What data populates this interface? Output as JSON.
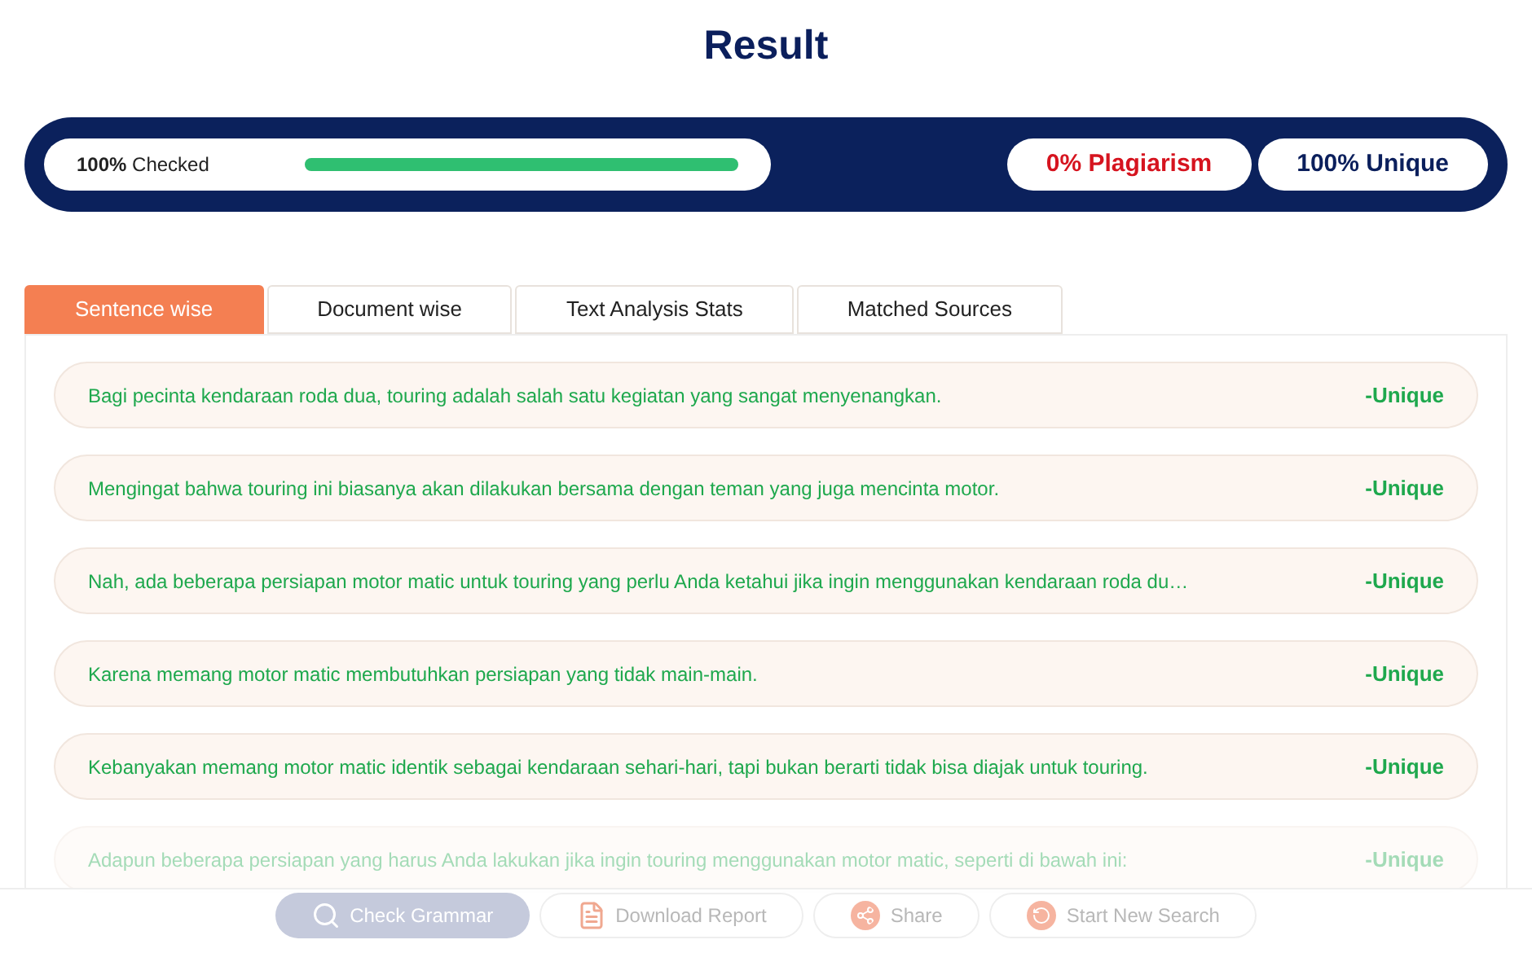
{
  "title": "Result",
  "summary": {
    "checked_label": "**100%** Checked",
    "level": 1,
    "plagiarism": "0% Plagiarism",
    "unique": "100% Unique"
  },
  "tabs": [
    {
      "label": "Sentence wise",
      "selected": true
    },
    {
      "label": "Document wise",
      "selected": false
    },
    {
      "label": "Text Analysis Stats",
      "selected": false
    },
    {
      "label": "Matched Sources",
      "selected": false
    }
  ],
  "sentences": [
    {
      "text": "Bagi pecinta kendaraan roda dua, touring adalah salah satu kegiatan yang sangat menyenangkan.",
      "status": "-Unique"
    },
    {
      "text": "Mengingat bahwa touring ini biasanya akan dilakukan bersama dengan teman yang juga mencinta motor.",
      "status": "-Unique"
    },
    {
      "text": "Nah, ada beberapa persiapan motor matic untuk touring yang perlu Anda ketahui jika ingin menggunakan kendaraan roda du…",
      "status": "-Unique"
    },
    {
      "text": "Karena memang motor matic membutuhkan persiapan yang tidak main-main.",
      "status": "-Unique"
    },
    {
      "text": "Kebanyakan memang motor matic identik sebagai kendaraan sehari-hari, tapi bukan berarti tidak bisa diajak untuk touring.",
      "status": "-Unique"
    },
    {
      "text": "Adapun beberapa persiapan yang harus Anda lakukan jika ingin touring menggunakan motor matic, seperti di bawah ini:",
      "status": "-Unique"
    }
  ],
  "actions": [
    {
      "kind": "grammar",
      "label": "Check Grammar"
    },
    {
      "kind": "download",
      "label": "Download Report"
    },
    {
      "kind": "share",
      "label": "Share"
    },
    {
      "kind": "restart",
      "label": "Start New Search"
    }
  ]
}
